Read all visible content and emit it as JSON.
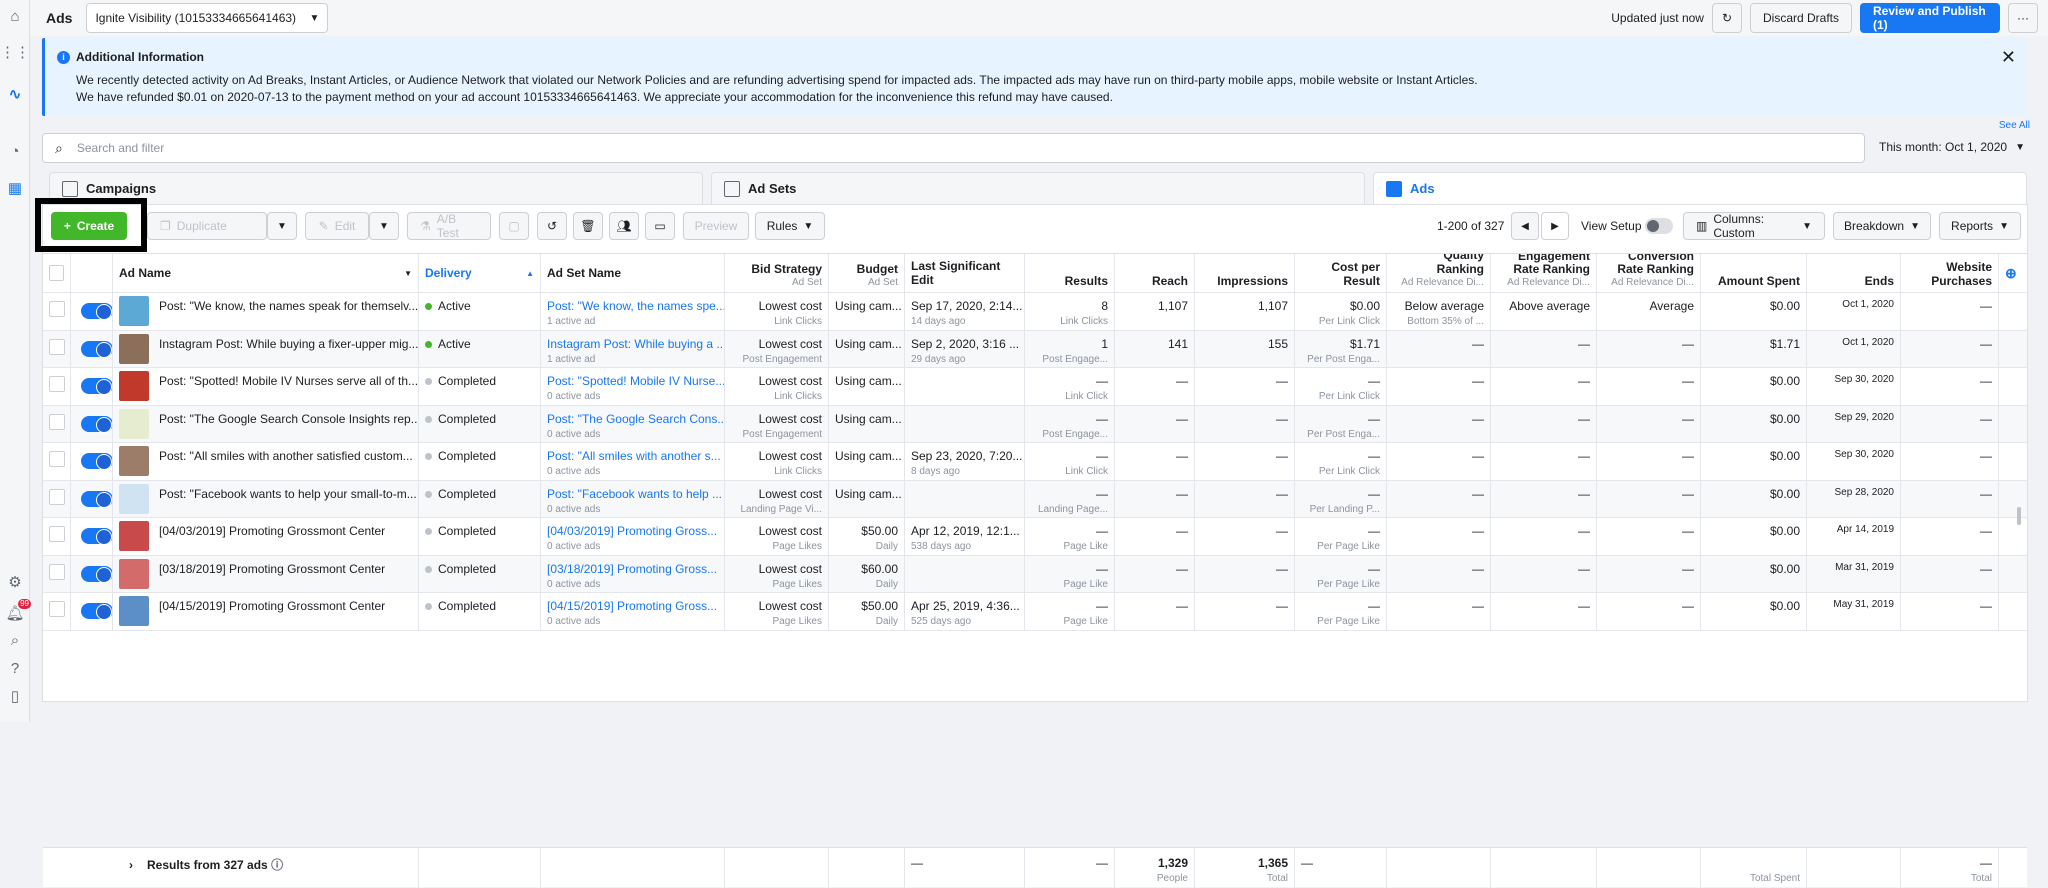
{
  "app": {
    "title": "Ads",
    "account": "Ignite Visibility (10153334665641463)"
  },
  "header": {
    "updated": "Updated just now",
    "discard": "Discard Drafts",
    "review_publish": "Review and Publish (1)"
  },
  "notice": {
    "title": "Additional Information",
    "line1": "We recently detected activity on Ad Breaks, Instant Articles, or Audience Network that violated our Network Policies and are refunding advertising spend for impacted ads. The impacted ads may have run on third-party mobile apps, mobile website or Instant Articles.",
    "line2": "We have refunded $0.01 on 2020-07-13 to the payment method on your ad account 10153334665641463. We appreciate your accommodation for the inconvenience this refund may have caused."
  },
  "see_all": "See All",
  "search": {
    "placeholder": "Search and filter"
  },
  "date_range": "This month: Oct 1, 2020",
  "tabs": {
    "campaigns": "Campaigns",
    "adsets": "Ad Sets",
    "ads": "Ads"
  },
  "toolbar": {
    "create": "Create",
    "duplicate": "Duplicate",
    "edit": "Edit",
    "ab_test": "A/B Test",
    "preview": "Preview",
    "rules": "Rules",
    "pager": "1-200 of 327",
    "view_setup": "View Setup",
    "columns": "Columns: Custom",
    "breakdown": "Breakdown",
    "reports": "Reports"
  },
  "columns": {
    "ad_name": "Ad Name",
    "delivery": "Delivery",
    "ad_set_name": "Ad Set Name",
    "bid_strategy": "Bid Strategy",
    "bid_strategy_sub": "Ad Set",
    "budget": "Budget",
    "budget_sub": "Ad Set",
    "last_edit": "Last Significant Edit",
    "results": "Results",
    "reach": "Reach",
    "impressions": "Impressions",
    "cost_per_result": "Cost per Result",
    "quality": "Quality Ranking",
    "quality_sub": "Ad Relevance Di...",
    "engagement": "Engagement Rate Ranking",
    "engagement_sub": "Ad Relevance Di...",
    "conversion": "Conversion Rate Ranking",
    "conversion_sub": "Ad Relevance Di...",
    "amount_spent": "Amount Spent",
    "ends": "Ends",
    "website_purchases": "Website Purchases"
  },
  "rows": [
    {
      "name": "Post: \"We know, the names speak for themselv...",
      "delivery": "Active",
      "adset": "Post: \"We know, the names spe...",
      "adset_sub": "1 active ad",
      "bid": "Lowest cost",
      "bid_sub": "Link Clicks",
      "budget": "Using cam...",
      "budget_sub": "",
      "edit": "Sep 17, 2020, 2:14...",
      "edit_sub": "14 days ago",
      "results": "8",
      "results_sub": "Link Clicks",
      "reach": "1,107",
      "impr": "1,107",
      "cpr": "$0.00",
      "cpr_sub": "Per Link Click",
      "quality": "Below average",
      "quality_sub": "Bottom 35% of ...",
      "engagement": "Above average",
      "conversion": "Average",
      "spent": "$0.00",
      "ends": "Oct 1, 2020",
      "purch": "—"
    },
    {
      "name": "Instagram Post: While buying a fixer-upper mig...",
      "delivery": "Active",
      "adset": "Instagram Post: While buying a ...",
      "adset_sub": "1 active ad",
      "bid": "Lowest cost",
      "bid_sub": "Post Engagement",
      "budget": "Using cam...",
      "budget_sub": "",
      "edit": "Sep 2, 2020, 3:16 ...",
      "edit_sub": "29 days ago",
      "results": "1",
      "results_sub": "Post Engage...",
      "reach": "141",
      "impr": "155",
      "cpr": "$1.71",
      "cpr_sub": "Per Post Enga...",
      "quality": "—",
      "quality_sub": "",
      "engagement": "—",
      "conversion": "—",
      "spent": "$1.71",
      "ends": "Oct 1, 2020",
      "purch": "—"
    },
    {
      "name": "Post: \"Spotted! Mobile IV Nurses serve all of th...",
      "delivery": "Completed",
      "adset": "Post: \"Spotted! Mobile IV Nurse...",
      "adset_sub": "0 active ads",
      "bid": "Lowest cost",
      "bid_sub": "Link Clicks",
      "budget": "Using cam...",
      "budget_sub": "",
      "edit": "",
      "edit_sub": "",
      "results": "—",
      "results_sub": "Link Click",
      "reach": "—",
      "impr": "—",
      "cpr": "—",
      "cpr_sub": "Per Link Click",
      "quality": "—",
      "quality_sub": "",
      "engagement": "—",
      "conversion": "—",
      "spent": "$0.00",
      "ends": "Sep 30, 2020",
      "purch": "—"
    },
    {
      "name": "Post: \"The Google Search Console Insights rep...",
      "delivery": "Completed",
      "adset": "Post: \"The Google Search Cons...",
      "adset_sub": "0 active ads",
      "bid": "Lowest cost",
      "bid_sub": "Post Engagement",
      "budget": "Using cam...",
      "budget_sub": "",
      "edit": "",
      "edit_sub": "",
      "results": "—",
      "results_sub": "Post Engage...",
      "reach": "—",
      "impr": "—",
      "cpr": "—",
      "cpr_sub": "Per Post Enga...",
      "quality": "—",
      "quality_sub": "",
      "engagement": "—",
      "conversion": "—",
      "spent": "$0.00",
      "ends": "Sep 29, 2020",
      "purch": "—"
    },
    {
      "name": "Post: \"All smiles with another satisfied custom...",
      "delivery": "Completed",
      "adset": "Post: \"All smiles with another s...",
      "adset_sub": "0 active ads",
      "bid": "Lowest cost",
      "bid_sub": "Link Clicks",
      "budget": "Using cam...",
      "budget_sub": "",
      "edit": "Sep 23, 2020, 7:20...",
      "edit_sub": "8 days ago",
      "results": "—",
      "results_sub": "Link Click",
      "reach": "—",
      "impr": "—",
      "cpr": "—",
      "cpr_sub": "Per Link Click",
      "quality": "—",
      "quality_sub": "",
      "engagement": "—",
      "conversion": "—",
      "spent": "$0.00",
      "ends": "Sep 30, 2020",
      "purch": "—"
    },
    {
      "name": "Post: \"Facebook wants to help your small-to-m...",
      "delivery": "Completed",
      "adset": "Post: \"Facebook wants to help ...",
      "adset_sub": "0 active ads",
      "bid": "Lowest cost",
      "bid_sub": "Landing Page Vi...",
      "budget": "Using cam...",
      "budget_sub": "",
      "edit": "",
      "edit_sub": "",
      "results": "—",
      "results_sub": "Landing Page...",
      "reach": "—",
      "impr": "—",
      "cpr": "—",
      "cpr_sub": "Per Landing P...",
      "quality": "—",
      "quality_sub": "",
      "engagement": "—",
      "conversion": "—",
      "spent": "$0.00",
      "ends": "Sep 28, 2020",
      "purch": "—"
    },
    {
      "name": "[04/03/2019] Promoting Grossmont Center",
      "delivery": "Completed",
      "adset": "[04/03/2019] Promoting Gross...",
      "adset_sub": "0 active ads",
      "bid": "Lowest cost",
      "bid_sub": "Page Likes",
      "budget": "$50.00",
      "budget_sub": "Daily",
      "edit": "Apr 12, 2019, 12:1...",
      "edit_sub": "538 days ago",
      "results": "—",
      "results_sub": "Page Like",
      "reach": "—",
      "impr": "—",
      "cpr": "—",
      "cpr_sub": "Per Page Like",
      "quality": "—",
      "quality_sub": "",
      "engagement": "—",
      "conversion": "—",
      "spent": "$0.00",
      "ends": "Apr 14, 2019",
      "purch": "—"
    },
    {
      "name": "[03/18/2019] Promoting Grossmont Center",
      "delivery": "Completed",
      "adset": "[03/18/2019] Promoting Gross...",
      "adset_sub": "0 active ads",
      "bid": "Lowest cost",
      "bid_sub": "Page Likes",
      "budget": "$60.00",
      "budget_sub": "Daily",
      "edit": "",
      "edit_sub": "",
      "results": "—",
      "results_sub": "Page Like",
      "reach": "—",
      "impr": "—",
      "cpr": "—",
      "cpr_sub": "Per Page Like",
      "quality": "—",
      "quality_sub": "",
      "engagement": "—",
      "conversion": "—",
      "spent": "$0.00",
      "ends": "Mar 31, 2019",
      "purch": "—"
    },
    {
      "name": "[04/15/2019] Promoting Grossmont Center",
      "delivery": "Completed",
      "adset": "[04/15/2019] Promoting Gross...",
      "adset_sub": "0 active ads",
      "bid": "Lowest cost",
      "bid_sub": "Page Likes",
      "budget": "$50.00",
      "budget_sub": "Daily",
      "edit": "Apr 25, 2019, 4:36...",
      "edit_sub": "525 days ago",
      "results": "—",
      "results_sub": "Page Like",
      "reach": "—",
      "impr": "—",
      "cpr": "—",
      "cpr_sub": "Per Page Like",
      "quality": "—",
      "quality_sub": "",
      "engagement": "—",
      "conversion": "—",
      "spent": "$0.00",
      "ends": "May 31, 2019",
      "purch": "—"
    }
  ],
  "totals": {
    "label": "Results from 327 ads",
    "edit": "—",
    "results": "—",
    "reach": "1,329",
    "reach_sub": "People",
    "impr": "1,365",
    "impr_sub": "Total",
    "cpr": "—",
    "spent_sub": "Total Spent",
    "purch": "—",
    "purch_sub": "Total"
  },
  "colors": {
    "accent": "#1877f2",
    "create": "#42b72a",
    "active": "#42b72a",
    "completed": "#bec3c9"
  },
  "notifications_count": "99"
}
